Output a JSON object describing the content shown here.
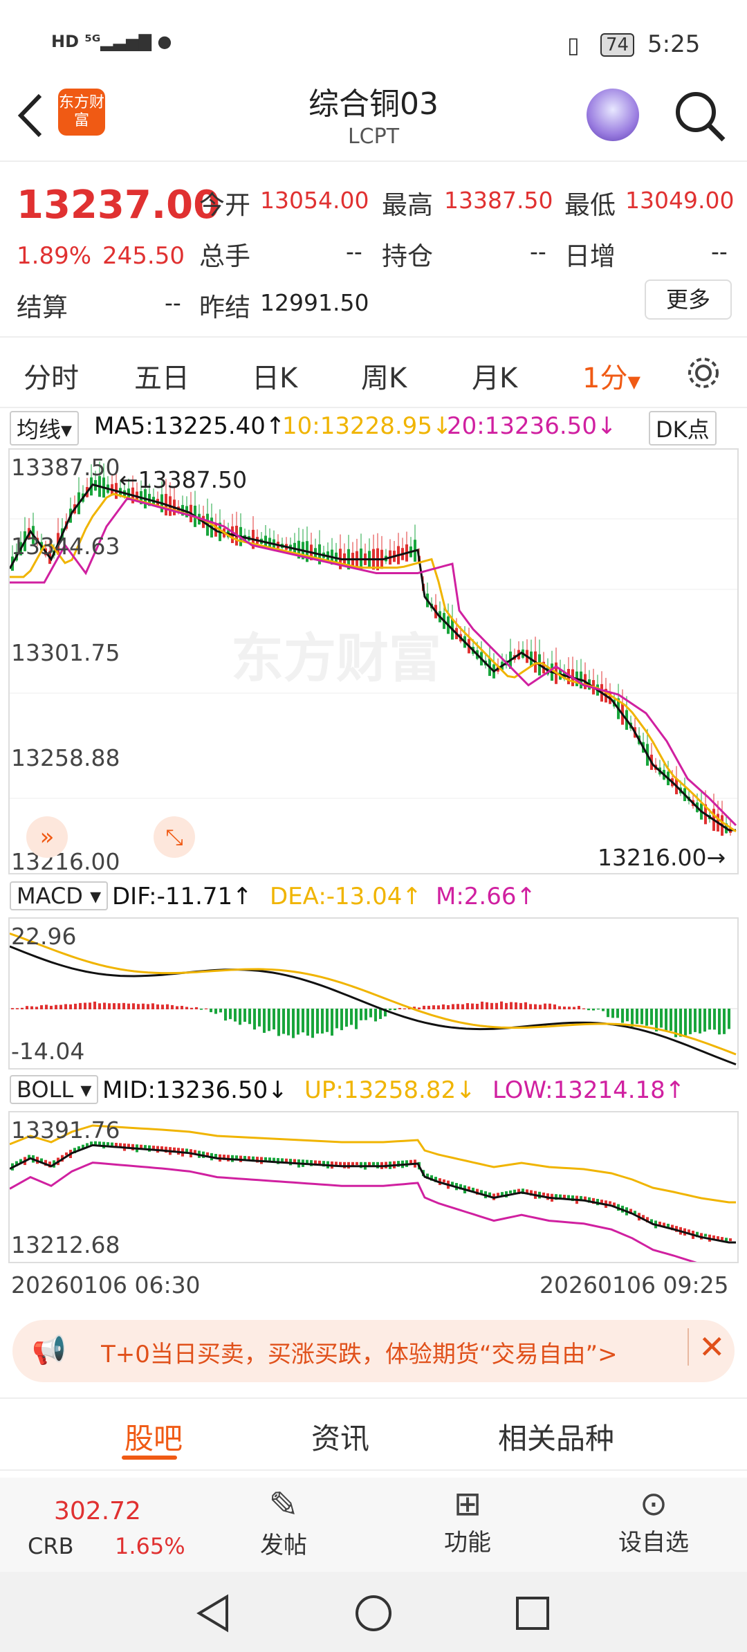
{
  "status": {
    "left_icons": "HD 5G signal wechat",
    "battery": "74",
    "time": "5:25"
  },
  "header": {
    "title": "综合铜03",
    "subtitle": "LCPT",
    "brand": "东方财富"
  },
  "quote": {
    "price": "13237.00",
    "pct": "1.89%",
    "change": "245.50",
    "open_label": "今开",
    "open": "13054.00",
    "high_label": "最高",
    "high": "13387.50",
    "low_label": "最低",
    "low": "13049.00",
    "vol_label": "总手",
    "vol": "--",
    "oi_label": "持仓",
    "oi": "--",
    "daily_label": "日增",
    "daily": "--",
    "settle_label": "结算",
    "settle": "--",
    "prev_label": "昨结",
    "prev": "12991.50",
    "more": "更多"
  },
  "tabs": [
    "分时",
    "五日",
    "日K",
    "周K",
    "月K",
    "1分"
  ],
  "ma": {
    "label": "均线",
    "ma5": "MA5:13225.40↑",
    "ma10": "10:13228.95↓",
    "ma20": "20:13236.50↓",
    "dk": "DK点"
  },
  "main_axis": {
    "y": [
      "13387.50",
      "13344.63",
      "13301.75",
      "13258.88",
      "13216.00"
    ],
    "high_mark": "13387.50",
    "low_mark": "13216.00",
    "watermark": "东方财富"
  },
  "macd": {
    "label": "MACD",
    "dif": "DIF:-11.71↑",
    "dea": "DEA:-13.04↑",
    "m": "M:2.66↑",
    "ymax": "22.96",
    "ymin": "-14.04"
  },
  "boll": {
    "label": "BOLL",
    "mid": "MID:13236.50↓",
    "up": "UP:13258.82↓",
    "low": "LOW:13214.18↑",
    "ymax": "13391.76",
    "ymin": "13212.68"
  },
  "time_axis": {
    "start": "20260106 06:30",
    "end": "20260106 09:25"
  },
  "ad": {
    "text": "T+0当日买卖，买涨买跌，体验期货“交易自由”>"
  },
  "bottom_tabs": [
    "股吧",
    "资讯",
    "相关品种"
  ],
  "toolbar": {
    "crb_value": "302.72",
    "crb_label": "CRB",
    "crb_pct": "1.65%",
    "post": "发帖",
    "func": "功能",
    "watch": "设自选"
  },
  "colors": {
    "up": "#e03131",
    "down": "#19a53c",
    "ma5": "#111111",
    "ma10": "#f0b400",
    "ma20": "#d020a0",
    "accent": "#f05a14"
  }
}
